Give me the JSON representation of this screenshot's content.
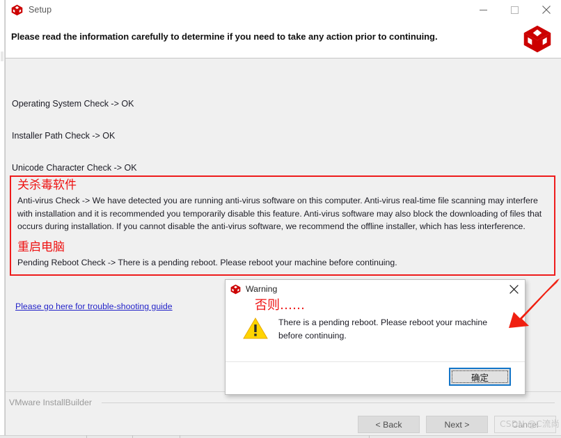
{
  "window": {
    "title": "Setup",
    "icon": "installbuilder-cube-icon",
    "controls": {
      "minimize": "minimize-icon",
      "maximize": "maximize-icon",
      "close": "close-icon"
    }
  },
  "header": {
    "instruction": "Please read the information carefully to determine if you need to take any action prior to continuing.",
    "logo": "installbuilder-cube-logo"
  },
  "checks": [
    {
      "label": "Operating System Check -> OK"
    },
    {
      "label": "Installer Path Check -> OK"
    },
    {
      "label": "Unicode Character Check ->  OK"
    }
  ],
  "annotations": {
    "antivirus_note": "关杀毒软件",
    "reboot_note": "重启电脑",
    "dialog_note": "否则……",
    "box_color": "#ee1b1b",
    "note_color": "#ee1212"
  },
  "warnings": {
    "antivirus": "Anti-virus Check -> We have detected you are running anti-virus software on this computer. Anti-virus real-time file scanning may interfere with installation and it is recommended you temporarily disable this feature. Anti-virus software may also block the downloading of files that occurs during installation. If you cannot disable the anti-virus software, we recommend the offline installer, which has less interference.",
    "pending_reboot": "Pending Reboot Check -> There is a pending reboot. Please reboot your machine before continuing."
  },
  "link": {
    "trouble_shooting": "Please go here for trouble-shooting guide",
    "color": "#2323c8"
  },
  "footer": {
    "brand": "VMware InstallBuilder",
    "buttons": [
      {
        "label": "< Back",
        "name": "back-button",
        "disabled": false
      },
      {
        "label": "Next >",
        "name": "next-button",
        "disabled": false
      },
      {
        "label": "Cancel",
        "name": "cancel-button",
        "disabled": true
      }
    ]
  },
  "watermark": "CSDN @C流尚",
  "dialog": {
    "title": "Warning",
    "icon": "installbuilder-cube-icon",
    "close": "close-icon",
    "alert_icon": "warning-triangle-icon",
    "message": "There is a pending reboot. Please reboot your machine before continuing.",
    "ok_label": "确定",
    "focus_color": "#1375c8"
  }
}
